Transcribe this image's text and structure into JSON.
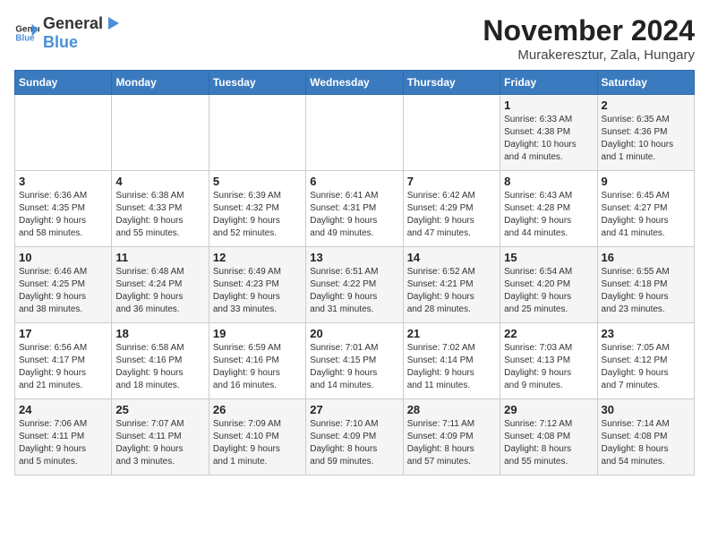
{
  "logo": {
    "general": "General",
    "blue": "Blue"
  },
  "title": "November 2024",
  "subtitle": "Murakeresztur, Zala, Hungary",
  "weekdays": [
    "Sunday",
    "Monday",
    "Tuesday",
    "Wednesday",
    "Thursday",
    "Friday",
    "Saturday"
  ],
  "weeks": [
    [
      {
        "day": "",
        "info": ""
      },
      {
        "day": "",
        "info": ""
      },
      {
        "day": "",
        "info": ""
      },
      {
        "day": "",
        "info": ""
      },
      {
        "day": "",
        "info": ""
      },
      {
        "day": "1",
        "info": "Sunrise: 6:33 AM\nSunset: 4:38 PM\nDaylight: 10 hours\nand 4 minutes."
      },
      {
        "day": "2",
        "info": "Sunrise: 6:35 AM\nSunset: 4:36 PM\nDaylight: 10 hours\nand 1 minute."
      }
    ],
    [
      {
        "day": "3",
        "info": "Sunrise: 6:36 AM\nSunset: 4:35 PM\nDaylight: 9 hours\nand 58 minutes."
      },
      {
        "day": "4",
        "info": "Sunrise: 6:38 AM\nSunset: 4:33 PM\nDaylight: 9 hours\nand 55 minutes."
      },
      {
        "day": "5",
        "info": "Sunrise: 6:39 AM\nSunset: 4:32 PM\nDaylight: 9 hours\nand 52 minutes."
      },
      {
        "day": "6",
        "info": "Sunrise: 6:41 AM\nSunset: 4:31 PM\nDaylight: 9 hours\nand 49 minutes."
      },
      {
        "day": "7",
        "info": "Sunrise: 6:42 AM\nSunset: 4:29 PM\nDaylight: 9 hours\nand 47 minutes."
      },
      {
        "day": "8",
        "info": "Sunrise: 6:43 AM\nSunset: 4:28 PM\nDaylight: 9 hours\nand 44 minutes."
      },
      {
        "day": "9",
        "info": "Sunrise: 6:45 AM\nSunset: 4:27 PM\nDaylight: 9 hours\nand 41 minutes."
      }
    ],
    [
      {
        "day": "10",
        "info": "Sunrise: 6:46 AM\nSunset: 4:25 PM\nDaylight: 9 hours\nand 38 minutes."
      },
      {
        "day": "11",
        "info": "Sunrise: 6:48 AM\nSunset: 4:24 PM\nDaylight: 9 hours\nand 36 minutes."
      },
      {
        "day": "12",
        "info": "Sunrise: 6:49 AM\nSunset: 4:23 PM\nDaylight: 9 hours\nand 33 minutes."
      },
      {
        "day": "13",
        "info": "Sunrise: 6:51 AM\nSunset: 4:22 PM\nDaylight: 9 hours\nand 31 minutes."
      },
      {
        "day": "14",
        "info": "Sunrise: 6:52 AM\nSunset: 4:21 PM\nDaylight: 9 hours\nand 28 minutes."
      },
      {
        "day": "15",
        "info": "Sunrise: 6:54 AM\nSunset: 4:20 PM\nDaylight: 9 hours\nand 25 minutes."
      },
      {
        "day": "16",
        "info": "Sunrise: 6:55 AM\nSunset: 4:18 PM\nDaylight: 9 hours\nand 23 minutes."
      }
    ],
    [
      {
        "day": "17",
        "info": "Sunrise: 6:56 AM\nSunset: 4:17 PM\nDaylight: 9 hours\nand 21 minutes."
      },
      {
        "day": "18",
        "info": "Sunrise: 6:58 AM\nSunset: 4:16 PM\nDaylight: 9 hours\nand 18 minutes."
      },
      {
        "day": "19",
        "info": "Sunrise: 6:59 AM\nSunset: 4:16 PM\nDaylight: 9 hours\nand 16 minutes."
      },
      {
        "day": "20",
        "info": "Sunrise: 7:01 AM\nSunset: 4:15 PM\nDaylight: 9 hours\nand 14 minutes."
      },
      {
        "day": "21",
        "info": "Sunrise: 7:02 AM\nSunset: 4:14 PM\nDaylight: 9 hours\nand 11 minutes."
      },
      {
        "day": "22",
        "info": "Sunrise: 7:03 AM\nSunset: 4:13 PM\nDaylight: 9 hours\nand 9 minutes."
      },
      {
        "day": "23",
        "info": "Sunrise: 7:05 AM\nSunset: 4:12 PM\nDaylight: 9 hours\nand 7 minutes."
      }
    ],
    [
      {
        "day": "24",
        "info": "Sunrise: 7:06 AM\nSunset: 4:11 PM\nDaylight: 9 hours\nand 5 minutes."
      },
      {
        "day": "25",
        "info": "Sunrise: 7:07 AM\nSunset: 4:11 PM\nDaylight: 9 hours\nand 3 minutes."
      },
      {
        "day": "26",
        "info": "Sunrise: 7:09 AM\nSunset: 4:10 PM\nDaylight: 9 hours\nand 1 minute."
      },
      {
        "day": "27",
        "info": "Sunrise: 7:10 AM\nSunset: 4:09 PM\nDaylight: 8 hours\nand 59 minutes."
      },
      {
        "day": "28",
        "info": "Sunrise: 7:11 AM\nSunset: 4:09 PM\nDaylight: 8 hours\nand 57 minutes."
      },
      {
        "day": "29",
        "info": "Sunrise: 7:12 AM\nSunset: 4:08 PM\nDaylight: 8 hours\nand 55 minutes."
      },
      {
        "day": "30",
        "info": "Sunrise: 7:14 AM\nSunset: 4:08 PM\nDaylight: 8 hours\nand 54 minutes."
      }
    ]
  ]
}
